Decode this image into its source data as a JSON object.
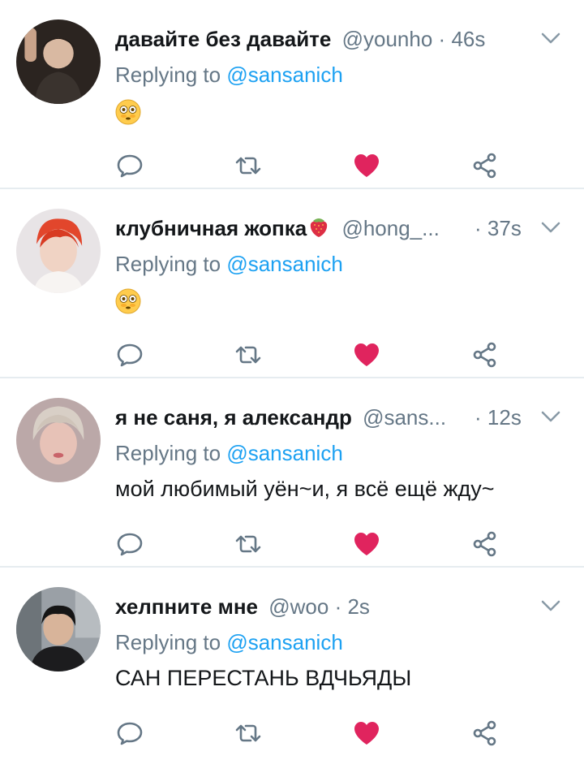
{
  "colors": {
    "link": "#1da1f2",
    "muted": "#657786",
    "like": "#e0245e",
    "divider": "#e6ecf0"
  },
  "tweets": [
    {
      "name": "давайте без давайте",
      "handle": "@younho",
      "dot": "·",
      "time": "46s",
      "replying_label": "Replying to",
      "replying_to": "@sansanich",
      "text": "",
      "emoji": "flushed-face",
      "name_emoji": ""
    },
    {
      "name": "клубничная жопка",
      "handle": "@hong_...",
      "dot": "·",
      "time": "37s",
      "replying_label": "Replying to",
      "replying_to": "@sansanich",
      "text": "",
      "emoji": "flushed-face",
      "name_emoji": "strawberry"
    },
    {
      "name": "я не саня, я александр",
      "handle": "@sans...",
      "dot": "·",
      "time": "12s",
      "replying_label": "Replying to",
      "replying_to": "@sansanich",
      "text": "мой любимый уён~и, я всё ещё жду~",
      "emoji": "",
      "name_emoji": ""
    },
    {
      "name": "хелпните мне",
      "handle": "@woo",
      "dot": "·",
      "time": "2s",
      "replying_label": "Replying to",
      "replying_to": "@sansanich",
      "text": "САН ПЕРЕСТАНЬ ВДЧЬЯДЫ",
      "emoji": "",
      "name_emoji": ""
    }
  ],
  "icons": {
    "reply": "reply-icon",
    "retweet": "retweet-icon",
    "like": "heart-icon",
    "share": "share-icon",
    "more": "chevron-down-icon"
  }
}
